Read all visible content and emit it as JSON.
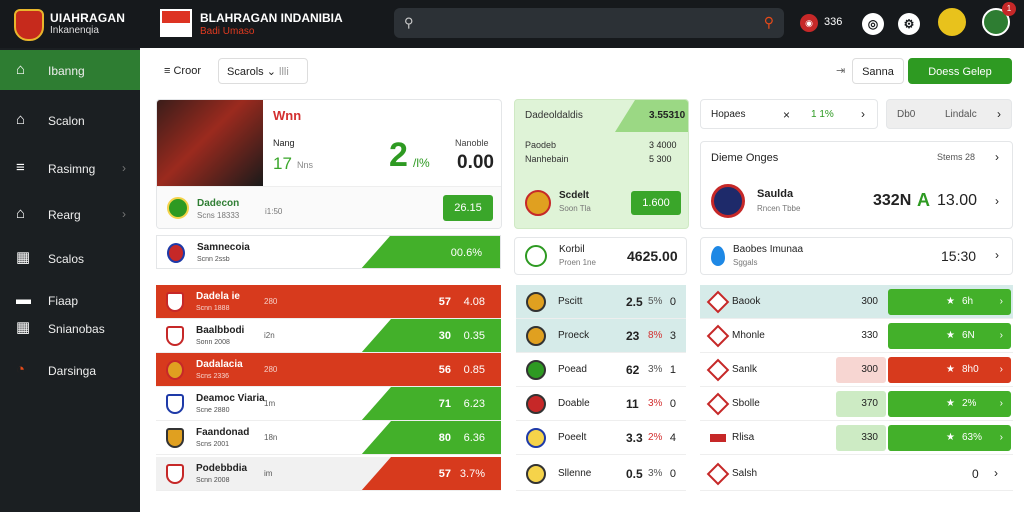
{
  "top": {
    "brand_line1": "UIAHRAGAN",
    "brand_line2": "Inkanenqia",
    "title": "BLAHRAGAN INDANIBIA",
    "subtitle": "Badi Umaso",
    "notif_count": "336",
    "badge": "1"
  },
  "sidebar": {
    "items": [
      {
        "label": "Ibanng",
        "icon": "home-icon"
      },
      {
        "label": "Scalon",
        "icon": "home-icon"
      },
      {
        "label": "Rasimng",
        "icon": "menu-icon"
      },
      {
        "label": "Rearg",
        "icon": "home-icon"
      },
      {
        "label": "Scalos",
        "icon": "grid-icon"
      },
      {
        "label": "Fiaap",
        "icon": "bars-icon"
      },
      {
        "label": "Snianobas",
        "icon": "grid-icon"
      },
      {
        "label": "Darsinga",
        "icon": "q-icon"
      }
    ]
  },
  "filters": {
    "label": "Croor",
    "dropdown": "Scarols",
    "dd_suffix": "llli",
    "right_btn": "Sanna",
    "green_btn": "Doess Gelep"
  },
  "hero": {
    "title": "Wnn",
    "sub": "Nang",
    "score": "17",
    "score_unit": "Nns",
    "big": "2",
    "big_suffix": "/l%",
    "right_label": "Nanoble",
    "right_value": "0.00",
    "team": "Dadecon",
    "team_sub": "Scns 18333",
    "time": "i1:50",
    "btn": "26.15"
  },
  "single_row": {
    "name": "Samnecoia",
    "sub": "Scnn 2ssb",
    "val": "00.6%"
  },
  "rows": [
    {
      "name": "Dadela ie",
      "sub": "Scnn 1888",
      "time": "280",
      "a": "57",
      "b": "4.08",
      "style": "red"
    },
    {
      "name": "Baalbbodi",
      "sub": "Sonn 2008",
      "time": "i2n",
      "a": "30",
      "b": "0.35",
      "style": "white"
    },
    {
      "name": "Dadalacia",
      "sub": "Scns 2336",
      "time": "280",
      "a": "56",
      "b": "0.85",
      "style": "red"
    },
    {
      "name": "Deamoc Viaria",
      "sub": "Scne 2880",
      "time": "1m",
      "a": "71",
      "b": "6.23",
      "style": "white"
    },
    {
      "name": "Faandonad",
      "sub": "Scns 2001",
      "time": "18n",
      "a": "80",
      "b": "6.36",
      "style": "white"
    },
    {
      "name": "Podebbdia",
      "sub": "Scnn 2008",
      "time": "im",
      "a": "57",
      "b": "3.7%",
      "style": "red"
    }
  ],
  "mid_card": {
    "title": "Dadeoldaldis",
    "value": "3.55310",
    "l1": "Paodeb",
    "v1": "3 4000",
    "l2": "Nanhebain",
    "v2": "5 300",
    "team": "Scdelt",
    "team_sub": "Soon Tla",
    "btn": "1.600"
  },
  "mid_single": {
    "name": "Korbil",
    "sub": "Proen 1ne",
    "val": "4625.00"
  },
  "mid_rows": [
    {
      "name": "Pscitt",
      "v": "2.5",
      "p": "5%",
      "e": "0"
    },
    {
      "name": "Proeck",
      "v": "23",
      "p": "8%",
      "e": "3"
    },
    {
      "name": "Poead",
      "v": "62",
      "p": "3%",
      "e": "1"
    },
    {
      "name": "Doable",
      "v": "11",
      "p": "3%",
      "e": "0"
    },
    {
      "name": "Poeelt",
      "v": "3.3",
      "p": "2%",
      "e": "4"
    },
    {
      "name": "Sllenne",
      "v": "0.5",
      "p": "3%",
      "e": "0"
    }
  ],
  "right_top": {
    "label": "Hopaes",
    "x": "×",
    "val": "1 1%",
    "btn1": "Db0",
    "btn2": "Lindalc"
  },
  "right_card": {
    "title": "Dieme Onges",
    "tag": "Stems 28",
    "team": "Saulda",
    "team_sub": "Rncen Tbbe",
    "score": "332N",
    "arrow": "A",
    "val": "13.00"
  },
  "right_single": {
    "name": "Baobes Imunaa",
    "sub": "Sggals",
    "val": "15:30"
  },
  "right_rows": [
    {
      "name": "Baook",
      "q": "300",
      "g": "6h",
      "style": "alt"
    },
    {
      "name": "Mhonle",
      "q": "330",
      "g": "6N",
      "style": "plain"
    },
    {
      "name": "Sanlk",
      "q": "300",
      "g": "8h0",
      "style": "red"
    },
    {
      "name": "Sbolle",
      "q": "370",
      "g": "2%",
      "style": "lightgreen"
    },
    {
      "name": "Rlisa",
      "q": "330",
      "g": "63%",
      "style": "lightgreen"
    },
    {
      "name": "Salsh",
      "q": "",
      "g": "0",
      "style": "plain"
    }
  ]
}
